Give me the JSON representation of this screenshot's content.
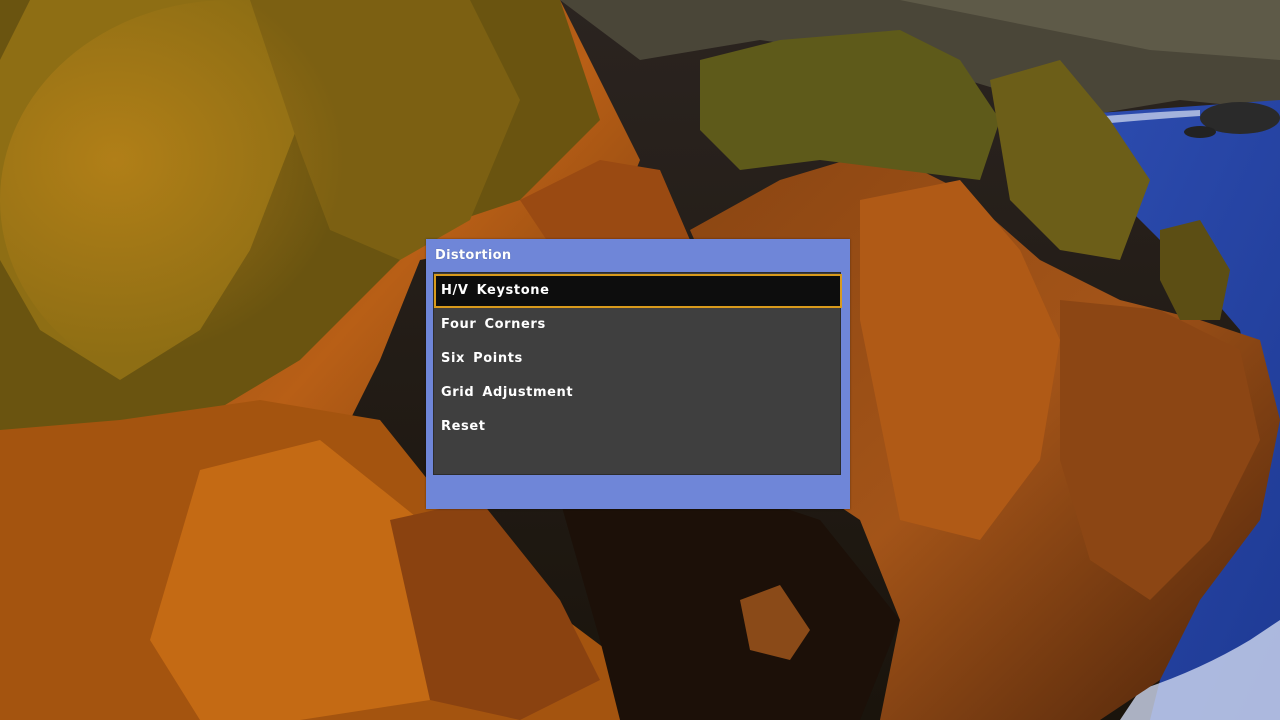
{
  "background": {
    "description_icon": "landscape-photo"
  },
  "menu": {
    "title": "Distortion",
    "items": [
      {
        "label": "H/V Keystone",
        "selected": true
      },
      {
        "label": "Four Corners",
        "selected": false
      },
      {
        "label": "Six Points",
        "selected": false
      },
      {
        "label": "Grid Adjustment",
        "selected": false
      },
      {
        "label": "Reset",
        "selected": false
      }
    ]
  },
  "colors": {
    "frame": "#6f86d8",
    "panel": "#3f3f3f",
    "selection_border": "#d89a1c",
    "selection_fill": "#0d0d0d",
    "text": "#ffffff"
  }
}
